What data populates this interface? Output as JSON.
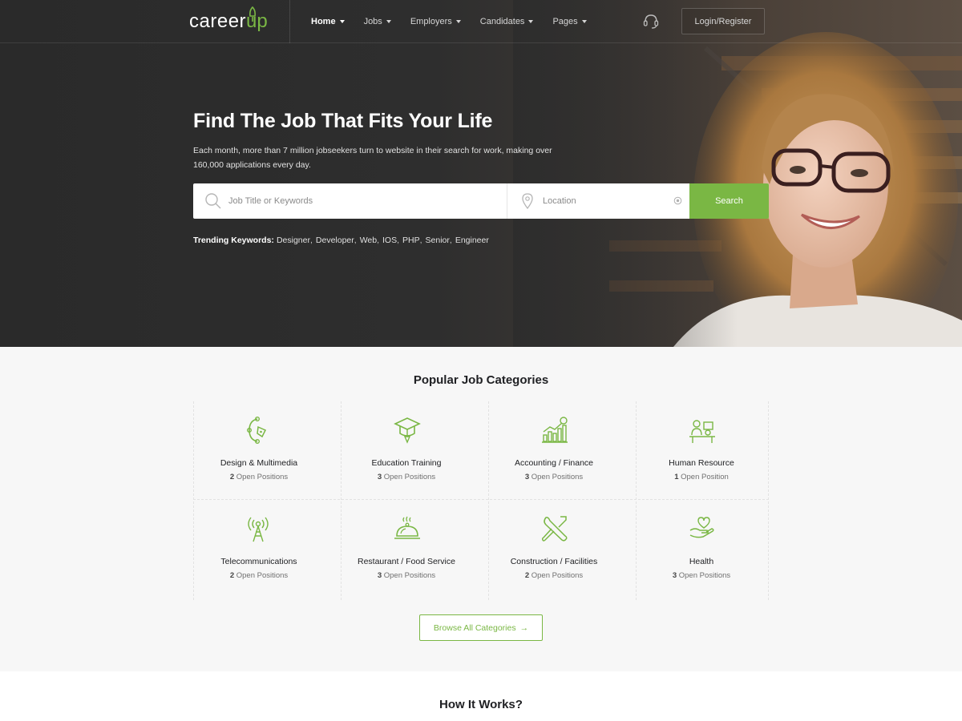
{
  "brand": {
    "logo_main": "career",
    "logo_accent": "up",
    "accent_color": "#7ab744"
  },
  "nav": {
    "items": [
      {
        "label": "Home",
        "active": true
      },
      {
        "label": "Jobs",
        "active": false
      },
      {
        "label": "Employers",
        "active": false
      },
      {
        "label": "Candidates",
        "active": false
      },
      {
        "label": "Pages",
        "active": false
      }
    ],
    "support_icon": "headset-icon",
    "login_label": "Login/Register"
  },
  "hero": {
    "title": "Find The Job That Fits Your Life",
    "subtitle": "Each month, more than 7 million jobseekers turn to website in their search for work, making over 160,000 applications every day."
  },
  "search": {
    "keyword_placeholder": "Job Title or Keywords",
    "location_placeholder": "Location",
    "button_label": "Search",
    "keyword_icon": "search-icon",
    "location_icon": "map-pin-icon",
    "locate_icon": "target-icon"
  },
  "trending": {
    "label": "Trending Keywords:",
    "keywords": [
      "Designer",
      "Developer",
      "Web",
      "IOS",
      "PHP",
      "Senior",
      "Engineer"
    ]
  },
  "categories": {
    "title": "Popular Job Categories",
    "items": [
      {
        "name": "Design & Multimedia",
        "count": "2",
        "suffix": " Open Positions",
        "icon": "pen-tool-icon"
      },
      {
        "name": "Education Training",
        "count": "3",
        "suffix": " Open Positions",
        "icon": "graduation-cap-icon"
      },
      {
        "name": "Accounting / Finance",
        "count": "3",
        "suffix": " Open Positions",
        "icon": "bar-chart-icon"
      },
      {
        "name": "Human Resource",
        "count": "1",
        "suffix": " Open Position",
        "icon": "team-desk-icon"
      },
      {
        "name": "Telecommunications",
        "count": "2",
        "suffix": " Open Positions",
        "icon": "antenna-tower-icon"
      },
      {
        "name": "Restaurant / Food Service",
        "count": "3",
        "suffix": " Open Positions",
        "icon": "food-cloche-icon"
      },
      {
        "name": "Construction / Facilities",
        "count": "2",
        "suffix": " Open Positions",
        "icon": "wrench-screwdriver-icon"
      },
      {
        "name": "Health",
        "count": "3",
        "suffix": " Open Positions",
        "icon": "heart-hand-icon"
      }
    ],
    "browse_label": "Browse All Categories",
    "browse_arrow": "→"
  },
  "how": {
    "title": "How It Works?"
  }
}
